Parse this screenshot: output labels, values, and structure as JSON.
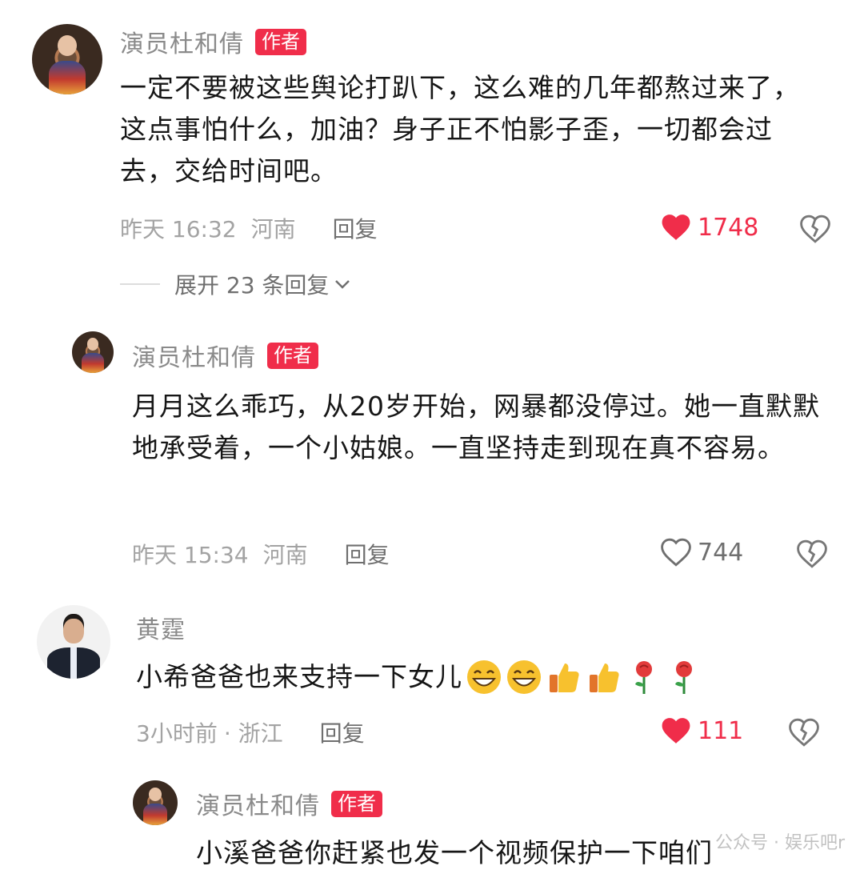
{
  "comments": [
    {
      "name": "演员杜和倩",
      "badge": "作者",
      "text": "一定不要被这些舆论打趴下，这么难的几年都熬过来了，这点事怕什么，加油？身子正不怕影子歪，一切都会过去，交给时间吧。",
      "time": "昨天 16:32",
      "location": "河南",
      "reply": "回复",
      "likes": "1748",
      "liked": true,
      "expand": "展开 23 条回复"
    },
    {
      "name": "演员杜和倩",
      "badge": "作者",
      "text": "月月这么乖巧，从20岁开始，网暴都没停过。她一直默默地承受着，一个小姑娘。一直坚持走到现在真不容易。",
      "time": "昨天 15:34",
      "location": "河南",
      "reply": "回复",
      "likes": "744",
      "liked": false
    },
    {
      "name": "黄霆",
      "text": "小希爸爸也来支持一下女儿",
      "emojis": [
        "grin-emoji",
        "grin-emoji",
        "thumbs-up-emoji",
        "thumbs-up-emoji",
        "rose-emoji",
        "rose-emoji"
      ],
      "time": "3小时前",
      "location": "· 浙江",
      "reply": "回复",
      "likes": "111",
      "liked": true
    },
    {
      "name": "演员杜和倩",
      "badge": "作者",
      "text": "小溪爸爸你赶紧也发一个视频保护一下咱们"
    }
  ],
  "colors": {
    "accent": "#f02d4a",
    "like": "#f02d4a",
    "meta": "#a3a3a3",
    "name": "#8a8a8a"
  },
  "watermark": "公众号 · 娱乐吧r"
}
